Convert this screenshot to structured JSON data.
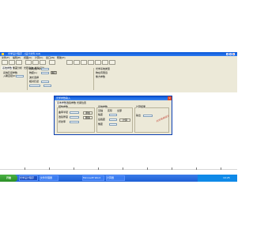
{
  "window": {
    "title": "光学设计程序 - [设计文件.dat]"
  },
  "menu": [
    "文件(F)",
    "编辑(E)",
    "视图(V)",
    "计算(C)",
    "窗口(W)",
    "帮助(H)"
  ],
  "ribbon": {
    "tabs": [
      "系统参数",
      "像差分析",
      "光路追迹",
      "优化设计"
    ],
    "left_labels": [
      "系统孔径参数",
      "入瞳直径(D)"
    ],
    "mid_labels": [
      "视场角(W)",
      "物距(L)",
      "波长选择",
      "相对孔径"
    ],
    "button": "确定",
    "right_labels": [
      "光学系统类型",
      "物在有限远",
      "像方参数"
    ]
  },
  "dialog": {
    "title": "光学参数输入",
    "tabs": [
      "基本参数",
      "透镜参数",
      "光阑位置"
    ],
    "group_left_label": "结构参数",
    "left_fields": [
      "曲率半径",
      "透镜厚度",
      "折射率"
    ],
    "side_buttons": [
      "添加",
      "删除"
    ],
    "group_mid_label": "系统参数",
    "mid_checks": [
      "近轴",
      "实际",
      "全部"
    ],
    "mid_fields": [
      "焦距",
      "后截距",
      "像距"
    ],
    "compute_button": "计算",
    "group_right_label": "计算结果",
    "result_label": "输出",
    "red_annotation": "光学系统设计"
  },
  "taskbar": {
    "start": "开始",
    "tasks": [
      "光学设计程序",
      "文件管理器",
      "Microsoft Word",
      "计算器"
    ],
    "clock": "10:25"
  }
}
